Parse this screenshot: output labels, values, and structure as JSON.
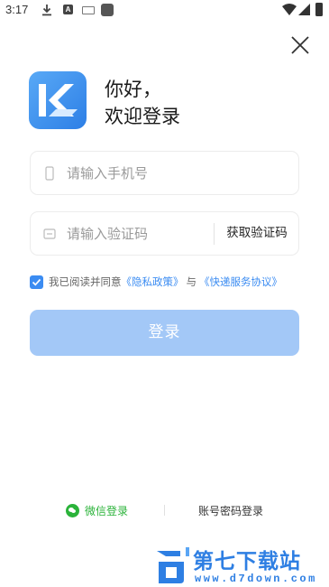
{
  "status_bar": {
    "time": "3:17",
    "badge_a": "A",
    "icons": [
      "download-icon",
      "a-badge-icon",
      "keyboard-icon",
      "app-square-icon",
      "wifi-icon",
      "signal-icon",
      "battery-icon"
    ]
  },
  "header": {
    "close_icon": "close-icon",
    "logo_icon": "app-logo-k",
    "greeting_line1": "你好，",
    "greeting_line2": "欢迎登录"
  },
  "form": {
    "phone_placeholder": "请输入手机号",
    "phone_value": "",
    "code_placeholder": "请输入验证码",
    "code_value": "",
    "get_code_label": "获取验证码",
    "agreement": {
      "checked": true,
      "prefix": "我已阅读并同意",
      "privacy_link": "《隐私政策》",
      "and": "与",
      "service_link": "《快递服务协议》"
    },
    "login_label": "登录"
  },
  "alt_login": {
    "wechat_label": "微信登录",
    "password_label": "账号密码登录"
  },
  "watermark": {
    "title": "第七下载站",
    "domain": "www.d7down.com"
  },
  "colors": {
    "accent": "#3b8cf2",
    "login_button_disabled": "#a3c8f7",
    "wechat_green": "#2bb33a",
    "watermark_blue": "#2e7fe3"
  }
}
